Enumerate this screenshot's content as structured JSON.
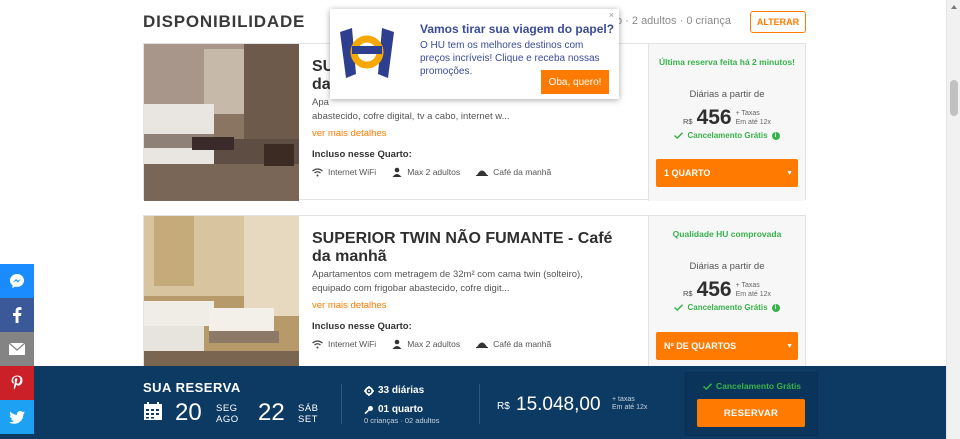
{
  "header": {
    "title": "DISPONIBILIDADE",
    "summary": "o · 2 adultos · 0 criança",
    "alter_label": "ALTERAR"
  },
  "rooms": [
    {
      "name_line1": "SU",
      "name_line2": "da",
      "description_line1": "Apa",
      "description_line2": "abastecido, cofre digital, tv a cabo, internet w...",
      "more_link": "ver mais detalhes",
      "included_label": "Incluso nesse Quarto:",
      "amenities": [
        "Internet WiFi",
        "Max 2 adultos",
        "Café da manhã"
      ],
      "badge": "Última reserva feita há 2 minutos!",
      "daily_from": "Diárias a partir de",
      "currency": "R$",
      "price": "456",
      "price_note1": "+ Taxas",
      "price_note2": "Em até 12x",
      "cancel_text": "Cancelamento Grátis",
      "select_label": "1 QUARTO"
    },
    {
      "name_line1": "SUPERIOR TWIN NÃO FUMANTE - Café",
      "name_line2": "da manhã",
      "description_line1": "Apartamentos com metragem de 32m² com cama twin (solteiro),",
      "description_line2": "equipado com frigobar abastecido, cofre digit...",
      "more_link": "ver mais detalhes",
      "included_label": "Incluso nesse Quarto:",
      "amenities": [
        "Internet WiFi",
        "Max 2 adultos",
        "Café da manhã"
      ],
      "badge": "Qualidade HU comprovada",
      "daily_from": "Diárias a partir de",
      "currency": "R$",
      "price": "456",
      "price_note1": "+ Taxas",
      "price_note2": "Em até 12x",
      "cancel_text": "Cancelamento Grátis",
      "select_label": "Nº DE QUARTOS"
    }
  ],
  "popup": {
    "close": "×",
    "title": "Vamos tirar sua viagem do papel?",
    "body": "O HU tem os melhores destinos com preços incríveis! Clique e receba nossas promoções.",
    "cta": "Oba, quero!"
  },
  "social": [
    {
      "icon": "messenger-icon",
      "color": "#1a8cff"
    },
    {
      "icon": "facebook-icon",
      "color": "#3b5998"
    },
    {
      "icon": "email-icon",
      "color": "#848484"
    },
    {
      "icon": "pinterest-icon",
      "color": "#cb2027"
    },
    {
      "icon": "twitter-icon",
      "color": "#1da1f2"
    }
  ],
  "reservation": {
    "title": "SUA RESERVA",
    "checkin_day": "20",
    "checkin_weekday": "SEG",
    "checkin_month": "AGO",
    "checkout_day": "22",
    "checkout_weekday": "SÁB",
    "checkout_month": "SET",
    "nights": "33 diárias",
    "rooms": "01 quarto",
    "guests": "0 crianças · 02 adultos",
    "currency": "R$",
    "total": "15.048,00",
    "total_note1": "+ taxas",
    "total_note2": "Em até 12x",
    "cancel_text": "Cancelamento Grátis",
    "reserve_label": "RESERVAR"
  },
  "colors": {
    "accent": "#ff7a00",
    "success": "#37b34a",
    "navy": "#0c3a63",
    "brand_blue": "#3a4b9c"
  }
}
